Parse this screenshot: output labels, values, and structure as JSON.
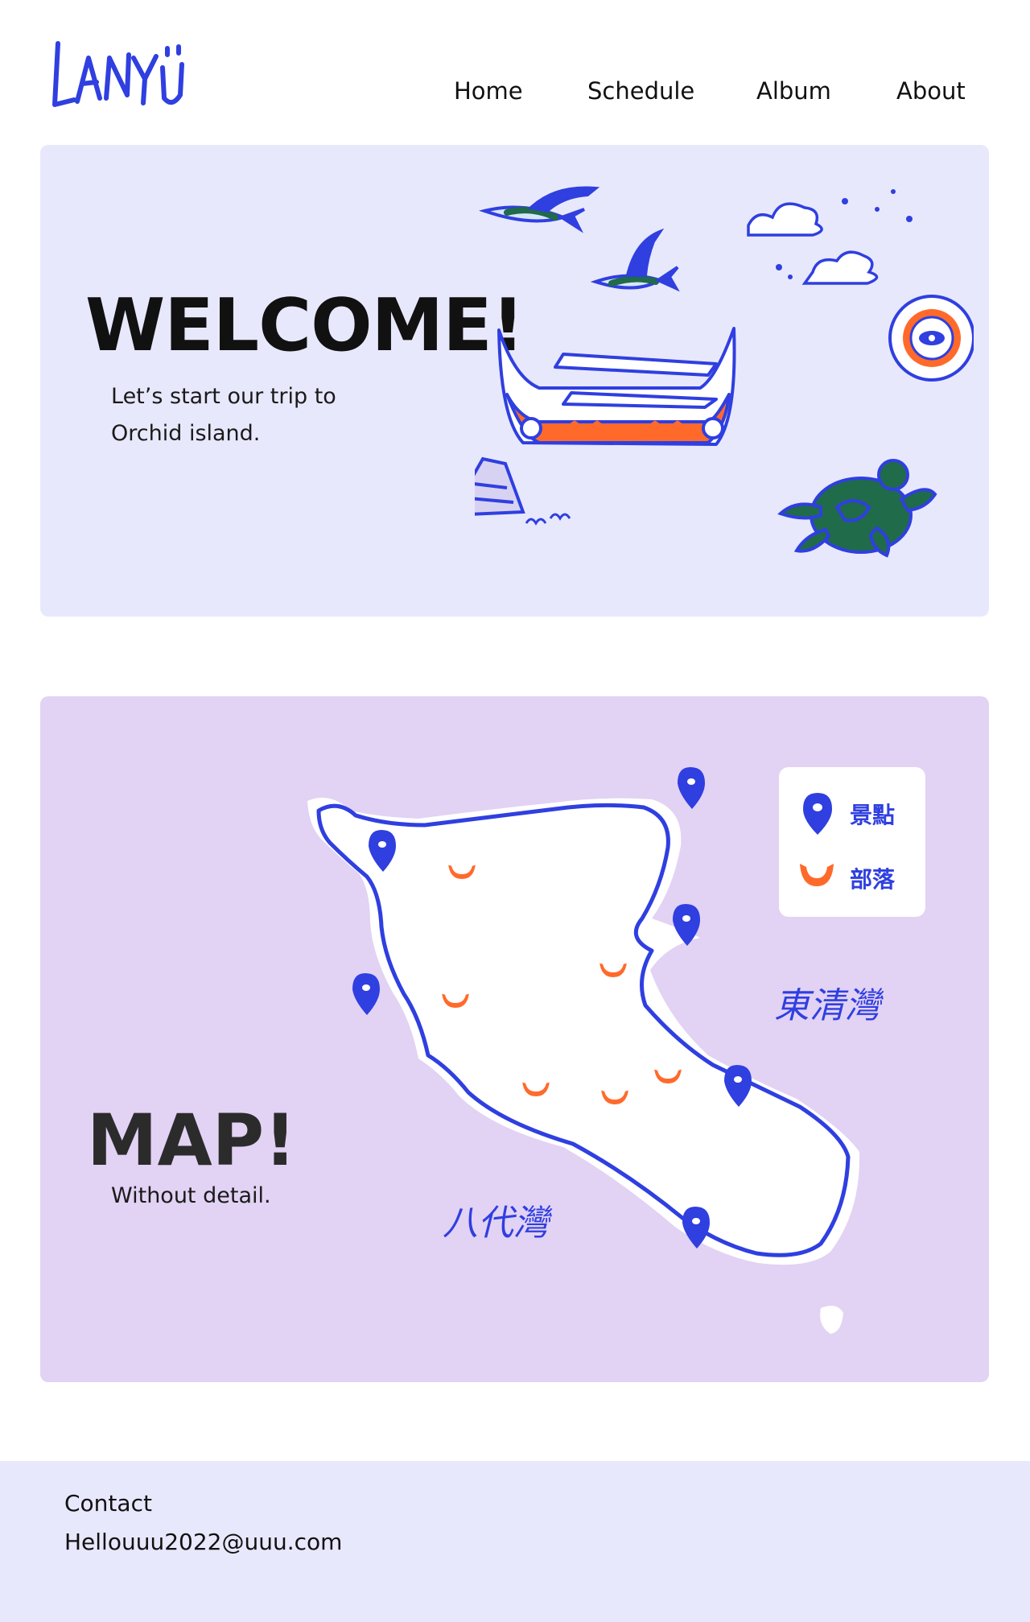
{
  "header": {
    "logo_text": "LANYU",
    "nav": [
      {
        "label": "Home"
      },
      {
        "label": "Schedule"
      },
      {
        "label": "Album"
      },
      {
        "label": "About"
      }
    ]
  },
  "hero": {
    "title": "WELCOME!",
    "subtitle_line1": "Let’s start our trip to",
    "subtitle_line2": "Orchid island."
  },
  "map": {
    "title": "MAP!",
    "subtitle": "Without detail.",
    "legend": [
      {
        "icon": "map-pin-icon",
        "label": "景點"
      },
      {
        "icon": "tribe-icon",
        "label": "部落"
      }
    ],
    "bay_east": "東清灣",
    "bay_west": "八代灣"
  },
  "footer": {
    "heading": "Contact",
    "email": "Hellouuu2022@uuu.com"
  },
  "colors": {
    "accent_blue": "#2f3fe0",
    "accent_orange": "#ff6a2b",
    "hero_bg": "#e8e8fd",
    "map_bg": "#e2d2f4"
  }
}
